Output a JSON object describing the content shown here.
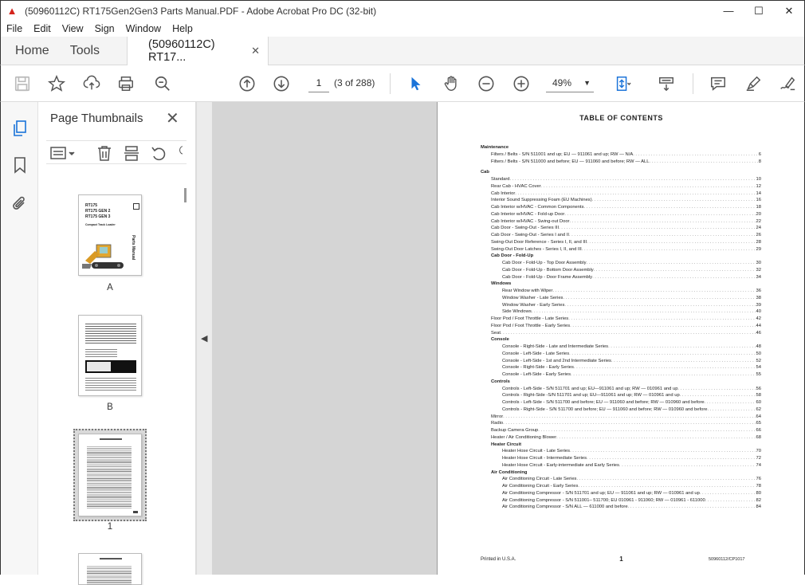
{
  "window": {
    "title": "(50960112C) RT175Gen2Gen3 Parts Manual.PDF - Adobe Acrobat Pro DC (32-bit)",
    "minimize": "—",
    "maximize": "☐",
    "close": "✕"
  },
  "menu": [
    "File",
    "Edit",
    "View",
    "Sign",
    "Window",
    "Help"
  ],
  "tabs": {
    "home": "Home",
    "tools": "Tools",
    "doc": "(50960112C) RT17...",
    "doc_close": "✕"
  },
  "toolbar": {
    "page_current": "1",
    "page_of": "(3 of 288)",
    "zoom": "49%",
    "icons": [
      "save-icon",
      "bookmark-star-icon",
      "upload-icon",
      "print-icon",
      "zoom-search-icon",
      "page-up-icon",
      "page-down-icon",
      "select-cursor-icon",
      "hand-icon",
      "zoom-out-icon",
      "zoom-in-icon",
      "page-fit-icon",
      "scroll-mode-icon",
      "comment-icon",
      "highlight-pen-icon",
      "sign-icon"
    ]
  },
  "panel": {
    "title": "Page Thumbnails",
    "close": "✕",
    "thumbs": [
      {
        "label": "A",
        "cover_lines": [
          "RT175",
          "RT175 GEN 2",
          "RT175 GEN 3",
          "Compact Track Loader",
          "Parts Manual"
        ]
      },
      {
        "label": "B"
      },
      {
        "label": "1"
      },
      {
        "label": ""
      }
    ]
  },
  "document": {
    "title": "TABLE OF CONTENTS",
    "toc": [
      {
        "lvl": "h",
        "text": "Maintenance",
        "page": ""
      },
      {
        "lvl": "1",
        "text": "Filters / Belts - S/N 511001 and up; EU — 911061 and up; RW — N/A",
        "page": "6"
      },
      {
        "lvl": "1",
        "text": "Filters / Belts - S/N 511000 and before; EU — 911060 and before; RW — ALL",
        "page": "8"
      },
      {
        "lvl": "gap"
      },
      {
        "lvl": "h",
        "text": "Cab",
        "page": ""
      },
      {
        "lvl": "1",
        "text": "Standard",
        "page": "10"
      },
      {
        "lvl": "1",
        "text": "Rear Cab - HVAC Cover",
        "page": "12"
      },
      {
        "lvl": "1",
        "text": "Cab Interior",
        "page": "14"
      },
      {
        "lvl": "1",
        "text": "Interior Sound Suppressing Foam (EU Machines)",
        "page": "16"
      },
      {
        "lvl": "1",
        "text": "Cab Interior w/HVAC - Common Components",
        "page": "18"
      },
      {
        "lvl": "1",
        "text": "Cab Interior w/HVAC - Fold-up Door",
        "page": "20"
      },
      {
        "lvl": "1",
        "text": "Cab Interior w/HVAC - Swing-out Door",
        "page": "22"
      },
      {
        "lvl": "1",
        "text": "Cab Door - Swing-Out - Series III",
        "page": "24"
      },
      {
        "lvl": "1",
        "text": "Cab Door - Swing-Out  - Series I and II",
        "page": "26"
      },
      {
        "lvl": "1",
        "text": "Swing-Out Door Reference - Series I, II, and III",
        "page": "28"
      },
      {
        "lvl": "1",
        "text": "Swing-Out Door Latches - Series I, II, and III",
        "page": "29"
      },
      {
        "lvl": "1h",
        "text": "Cab Door - Fold-Up",
        "page": ""
      },
      {
        "lvl": "2",
        "text": "Cab Door - Fold-Up - Top Door Assembly",
        "page": "30"
      },
      {
        "lvl": "2",
        "text": "Cab Door - Fold-Up - Bottom Door Assembly",
        "page": "32"
      },
      {
        "lvl": "2",
        "text": "Cab Door - Fold-Up - Door Frame Assembly",
        "page": "34"
      },
      {
        "lvl": "1h",
        "text": "Windows",
        "page": ""
      },
      {
        "lvl": "2",
        "text": "Rear Window with Wiper",
        "page": "36"
      },
      {
        "lvl": "2",
        "text": "Window Washer - Late Series",
        "page": "38"
      },
      {
        "lvl": "2",
        "text": "Window Washer - Early Series",
        "page": "39"
      },
      {
        "lvl": "2",
        "text": "Side Windows",
        "page": "40"
      },
      {
        "lvl": "1",
        "text": "Floor Pod / Foot Throttle - Late Series",
        "page": "42"
      },
      {
        "lvl": "1",
        "text": "Floor Pod / Foot Throttle - Early Series",
        "page": "44"
      },
      {
        "lvl": "1",
        "text": "Seat",
        "page": "46"
      },
      {
        "lvl": "1h",
        "text": "Console",
        "page": ""
      },
      {
        "lvl": "2",
        "text": "Console - Right-Side - Late and Intermediate Series",
        "page": "48"
      },
      {
        "lvl": "2",
        "text": "Console - Left-Side - Late Series",
        "page": "50"
      },
      {
        "lvl": "2",
        "text": "Console - Left-Side - 1st and 2nd Intermediate Series",
        "page": "52"
      },
      {
        "lvl": "2",
        "text": "Console - Right-Side - Early Series",
        "page": "54"
      },
      {
        "lvl": "2",
        "text": "Console - Left-Side - Early Series",
        "page": "55"
      },
      {
        "lvl": "1h",
        "text": "Controls",
        "page": ""
      },
      {
        "lvl": "2",
        "text": "Controls - Left-Side - S/N 511701 and up; EU—911061 and up; RW — 010961 and up",
        "page": "56"
      },
      {
        "lvl": "2",
        "text": "Controls - Right-Side -S/N 511701 and up; EU—911061 and up; RW — 010961 and up",
        "page": "58"
      },
      {
        "lvl": "2",
        "text": "Controls - Left-Side - S/N 511700 and before; EU — 911060 and before; RW — 010960 and before",
        "page": "60"
      },
      {
        "lvl": "2",
        "text": "Controls - Right-Side - S/N 511700 and before; EU — 911060 and before; RW — 010960 and before",
        "page": "62"
      },
      {
        "lvl": "1",
        "text": "Mirror",
        "page": "64"
      },
      {
        "lvl": "1",
        "text": "Radio",
        "page": "65"
      },
      {
        "lvl": "1",
        "text": "Backup Camera Group",
        "page": "66"
      },
      {
        "lvl": "1",
        "text": "Heater / Air Conditioning Blower",
        "page": "68"
      },
      {
        "lvl": "1h",
        "text": "Heater Circuit",
        "page": ""
      },
      {
        "lvl": "2",
        "text": "Heater Hose Circuit - Late Series",
        "page": "70"
      },
      {
        "lvl": "2",
        "text": "Heater Hose Circuit - Intermediate Series",
        "page": "72"
      },
      {
        "lvl": "2",
        "text": "Heater Hose Circuit - Early-intermediate and Early Series",
        "page": "74"
      },
      {
        "lvl": "1h",
        "text": "Air Conditioning",
        "page": ""
      },
      {
        "lvl": "2",
        "text": "Air Conditioning Circuit  - Late Series",
        "page": "76"
      },
      {
        "lvl": "2",
        "text": "Air Conditioning Circuit - Early Series",
        "page": "78"
      },
      {
        "lvl": "2",
        "text": "Air Conditioning Compressor - S/N 511701 and up; EU — 911061 and up; RW — 010961 and up",
        "page": "80"
      },
      {
        "lvl": "2",
        "text": "Air Conditioning Compressor - S/N 511001– 511700; EU 010961 - 911060; RW — 010961 - 611000",
        "page": "82"
      },
      {
        "lvl": "2",
        "text": "Air Conditioning Compressor - S/N ALL — 611000 and before",
        "page": "84"
      }
    ],
    "footer_left": "Printed in U.S.A.",
    "footer_center": "1",
    "footer_right": "50960112/CP1017"
  }
}
